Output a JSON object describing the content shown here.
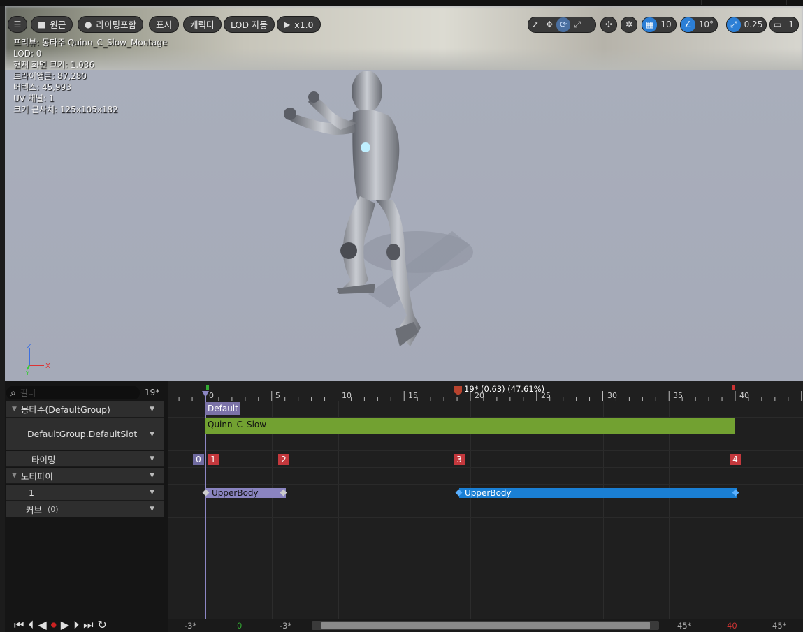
{
  "toolbar": {
    "perspective": "원근",
    "lighting": "라이팅포함",
    "show": "표시",
    "character": "캐릭터",
    "lod": "LOD 자동",
    "play_rate": "x1.0",
    "grid_value": "10",
    "angle_value": "10°",
    "scale_value": "0.25",
    "camera_speed": "1"
  },
  "stats": {
    "preview": "프리뷰: 몽타주 Quinn_C_Slow_Montage",
    "lod": "LOD: 0",
    "screen_size": "현재 화면 크기: 1.036",
    "triangles": "트라이앵글: 87,280",
    "vertices": "버텍스: 45,993",
    "uv_channels": "UV 채널: 1",
    "approx_size": "크기 근사치: 125x105x182"
  },
  "axis": {
    "z": "Z",
    "x": "X",
    "y": "Y"
  },
  "tracks": {
    "filter_placeholder": "필터",
    "frame": "19*",
    "montage_group": "몽타주(DefaultGroup)",
    "slot": "DefaultGroup.DefaultSlot",
    "timing": "타이밍",
    "notifies": "노티파이",
    "notify_track": "1",
    "curves": "커브",
    "curves_count": "(0)"
  },
  "timeline": {
    "playhead_label": "19* (0.63) (47.61%)",
    "ruler_labels": [
      "0",
      "5",
      "10",
      "15",
      "20",
      "25",
      "30",
      "35",
      "40"
    ],
    "section_name": "Default",
    "anim_segment": "Quinn_C_Slow",
    "timing_markers": [
      "0",
      "1",
      "2",
      "3",
      "4"
    ],
    "notify_states": [
      "UpperBody",
      "UpperBody"
    ]
  },
  "bottom": {
    "labels": [
      "-3*",
      "0",
      "-3*",
      "45*",
      "40",
      "45*"
    ]
  },
  "colors": {
    "anim_segment": "#72a131",
    "section": "#7b72a8",
    "marker": "#c4383d",
    "notify_selected": "#1a7fd4",
    "notify_normal": "#8a84c0",
    "accent": "#2c7fd6"
  }
}
